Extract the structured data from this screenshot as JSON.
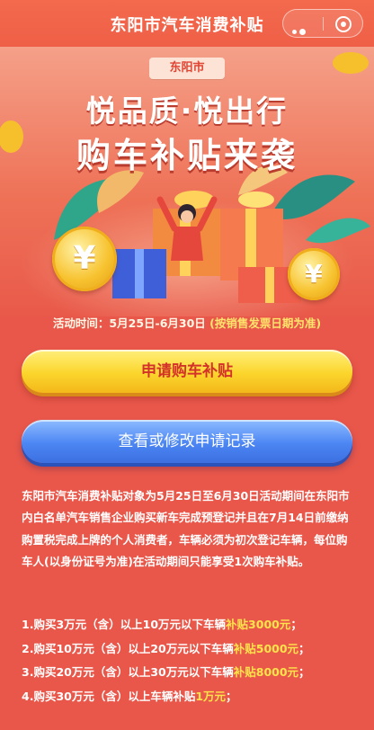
{
  "nav": {
    "title": "东阳市汽车消费补贴",
    "more_icon": "more-dots-icon",
    "close_icon": "target-close-icon"
  },
  "banner": {
    "city_tag": "东阳市",
    "headline_1": "悦品质·悦出行",
    "headline_2": "购车补贴来袭",
    "coin_symbol": "¥"
  },
  "activity": {
    "label": "活动时间：",
    "dates": "5月25日-6月30日",
    "note": "(按销售发票日期为准)"
  },
  "buttons": {
    "apply": "申请购车补贴",
    "records": "查看或修改申请记录"
  },
  "description": "东阳市汽车消费补贴对象为5月25日至6月30日活动期间在东阳市内白名单汽车销售企业购买新车完成预登记并且在7月14日前缴纳购置税完成上牌的个人消费者，车辆必须为初次登记车辆，每位购车人(以身份证号为准)在活动期间只能享受1次购车补贴。",
  "rules": [
    {
      "text": "1.购买3万元（含）以上10万元以下车辆",
      "amount": "补贴3000元",
      "tail": "；"
    },
    {
      "text": "2.购买10万元（含）以上20万元以下车辆",
      "amount": "补贴5000元",
      "tail": "；"
    },
    {
      "text": "3.购买20万元（含）以上30万元以下车辆",
      "amount": "补贴8000元",
      "tail": "；"
    },
    {
      "text": "4.购买30万元（含）以上车辆补贴",
      "amount": "1万元",
      "tail": "；"
    }
  ],
  "colors": {
    "page_bg": "#e9574a",
    "accent_yellow": "#ffe34a",
    "apply_button": "#fbd52c",
    "records_button": "#4c86f3",
    "city_tag_text": "#e04433"
  }
}
